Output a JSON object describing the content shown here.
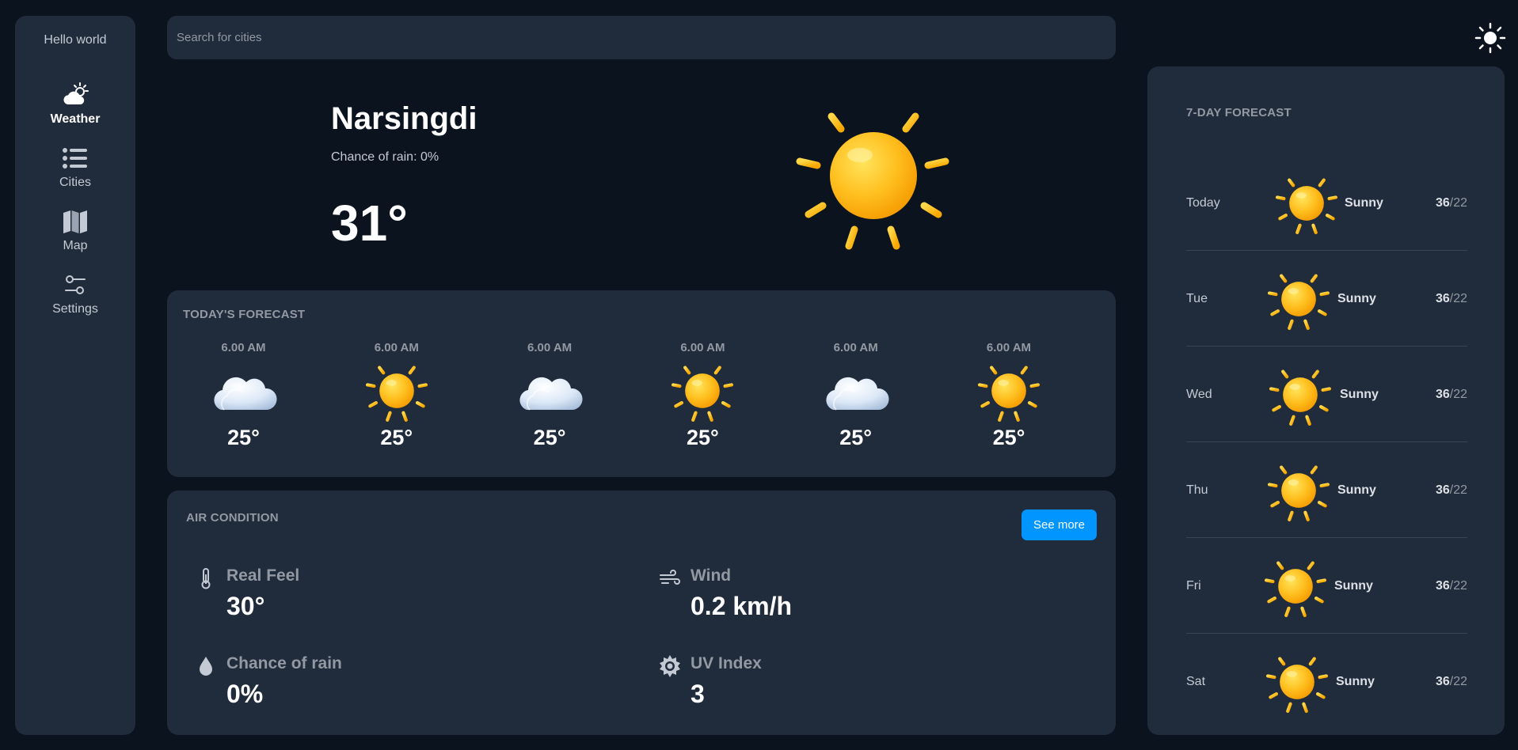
{
  "sidebar": {
    "greeting": "Hello world",
    "items": [
      {
        "label": "Weather",
        "icon": "cloud-sun-icon",
        "active": true
      },
      {
        "label": "Cities",
        "icon": "list-icon",
        "active": false
      },
      {
        "label": "Map",
        "icon": "map-icon",
        "active": false
      },
      {
        "label": "Settings",
        "icon": "sliders-icon",
        "active": false
      }
    ]
  },
  "search": {
    "placeholder": "Search for cities",
    "value": ""
  },
  "theme_toggle": {
    "icon": "sun-icon"
  },
  "current": {
    "city": "Narsingdi",
    "rain_chance": "Chance of rain: 0%",
    "temp": "31°",
    "icon": "sun-icon"
  },
  "today_forecast": {
    "title": "TODAY'S FORECAST",
    "hours": [
      {
        "time": "6.00 AM",
        "icon": "cloud-icon",
        "temp": "25°"
      },
      {
        "time": "6.00 AM",
        "icon": "sun-icon",
        "temp": "25°"
      },
      {
        "time": "6.00 AM",
        "icon": "cloud-icon",
        "temp": "25°"
      },
      {
        "time": "6.00 AM",
        "icon": "sun-icon",
        "temp": "25°"
      },
      {
        "time": "6.00 AM",
        "icon": "cloud-icon",
        "temp": "25°"
      },
      {
        "time": "6.00 AM",
        "icon": "sun-icon",
        "temp": "25°"
      }
    ]
  },
  "air_conditions": {
    "title": "AIR CONDITION",
    "see_more_label": "See more",
    "metrics": [
      {
        "label": "Real Feel",
        "value": "30°",
        "icon": "thermometer-icon"
      },
      {
        "label": "Wind",
        "value": "0.2 km/h",
        "icon": "wind-icon"
      },
      {
        "label": "Chance of rain",
        "value": "0%",
        "icon": "droplet-icon"
      },
      {
        "label": "UV Index",
        "value": "3",
        "icon": "uv-sun-icon"
      }
    ]
  },
  "week_forecast": {
    "title": "7-DAY FORECAST",
    "days": [
      {
        "day": "Today",
        "condition": "Sunny",
        "high": "36",
        "low": "/22",
        "icon": "sun-icon"
      },
      {
        "day": "Tue",
        "condition": "Sunny",
        "high": "36",
        "low": "/22",
        "icon": "sun-icon"
      },
      {
        "day": "Wed",
        "condition": "Sunny",
        "high": "36",
        "low": "/22",
        "icon": "sun-icon"
      },
      {
        "day": "Thu",
        "condition": "Sunny",
        "high": "36",
        "low": "/22",
        "icon": "sun-icon"
      },
      {
        "day": "Fri",
        "condition": "Sunny",
        "high": "36",
        "low": "/22",
        "icon": "sun-icon"
      },
      {
        "day": "Sat",
        "condition": "Sunny",
        "high": "36",
        "low": "/22",
        "icon": "sun-icon"
      }
    ]
  },
  "colors": {
    "background": "#0b131e",
    "panel": "#202b3b",
    "accent": "#0095ff",
    "muted_text": "#9399a2",
    "sun": "#ffb400"
  }
}
